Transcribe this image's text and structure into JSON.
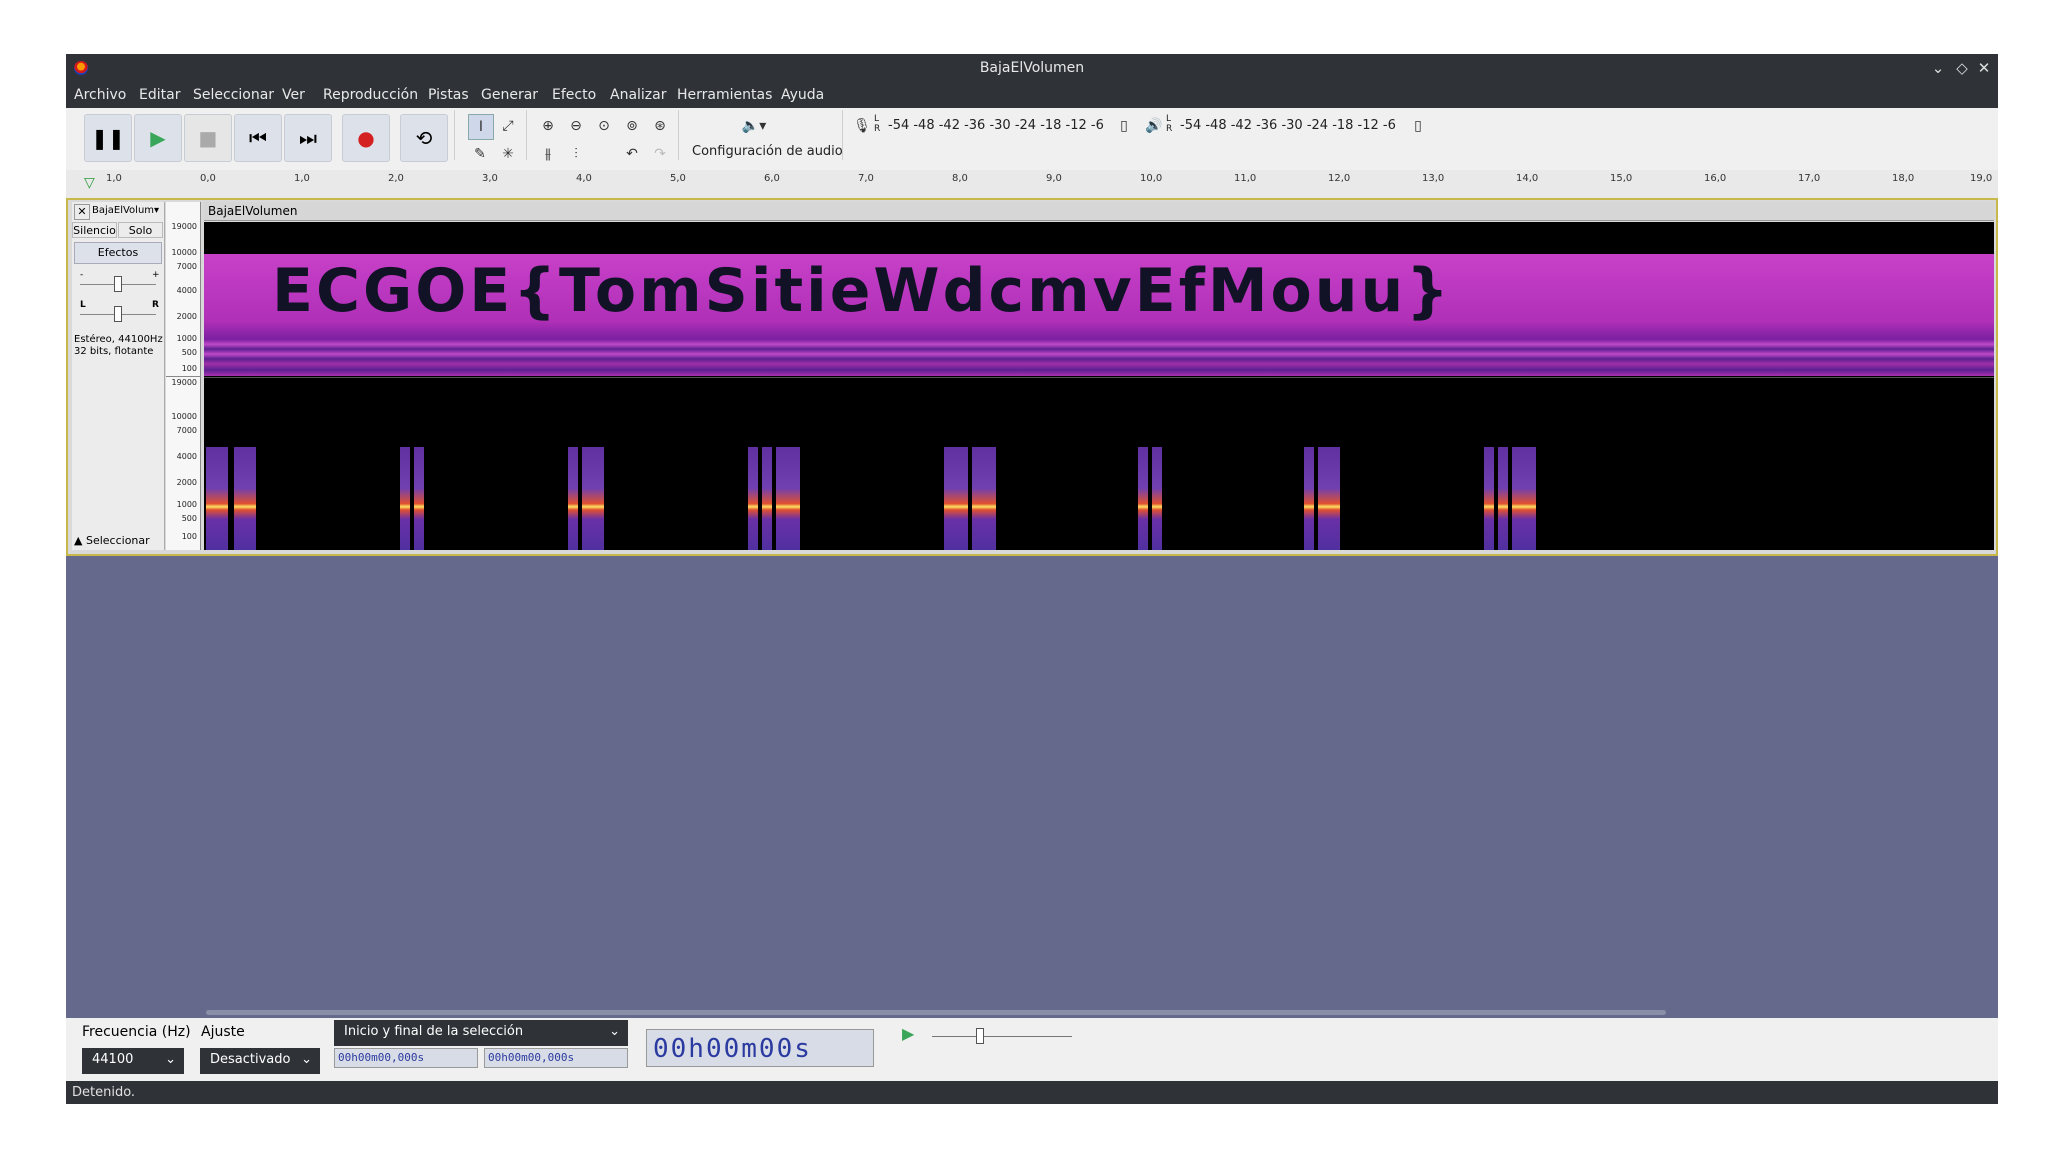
{
  "window": {
    "title": "BajaElVolumen"
  },
  "menu": [
    "Archivo",
    "Editar",
    "Seleccionar",
    "Ver",
    "Reproducción",
    "Pistas",
    "Generar",
    "Efecto",
    "Analizar",
    "Herramientas",
    "Ayuda"
  ],
  "toolbar": {
    "audio_setup_label": "Configuración de audio",
    "meter_rec_scale": "-54 -48 -42 -36 -30 -24 -18 -12  -6",
    "meter_play_scale": "-54 -48 -42 -36 -30 -24 -18 -12  -6"
  },
  "ruler": {
    "ticks": [
      "1,0",
      "0,0",
      "1,0",
      "2,0",
      "3,0",
      "4,0",
      "5,0",
      "6,0",
      "7,0",
      "8,0",
      "9,0",
      "10,0",
      "11,0",
      "12,0",
      "13,0",
      "14,0",
      "15,0",
      "16,0",
      "17,0",
      "18,0",
      "19,0"
    ]
  },
  "track": {
    "name": "BajaElVolum",
    "clip_name": "BajaElVolumen",
    "mute_label": "Silencio",
    "solo_label": "Solo",
    "effects_label": "Efectos",
    "format_line1": "Estéreo, 44100Hz",
    "format_line2": "32 bits, flotante",
    "select_label": "Seleccionar",
    "gain_minus": "-",
    "gain_plus": "+",
    "pan_left": "L",
    "pan_right": "R",
    "freq_labels": [
      "19000",
      "10000",
      "7000",
      "4000",
      "2000",
      "1000",
      "500",
      "100"
    ],
    "spectrogram_text": "ECGOE{TomSitieWdcmvEfMouu}"
  },
  "bottom": {
    "rate_label": "Frecuencia (Hz)",
    "snap_label": "Ajuste",
    "rate_value": "44100",
    "snap_value": "Desactivado",
    "selection_mode": "Inicio y final de la selección",
    "sel_start": "00h00m00,000s",
    "sel_end": "00h00m00,000s",
    "time_display": "00h00m00s"
  },
  "status": {
    "text": "Detenido."
  }
}
